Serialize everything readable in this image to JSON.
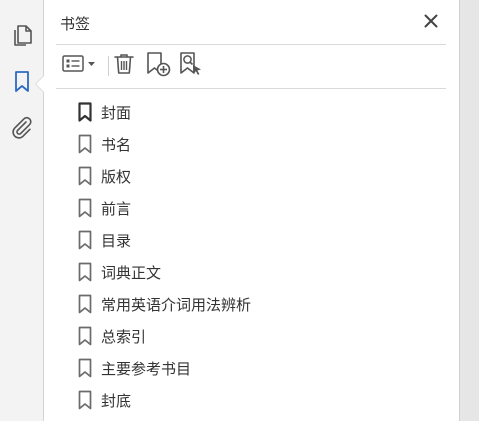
{
  "panel": {
    "title": "书签"
  },
  "icons": {
    "pages": "pages-icon",
    "bookmarks": "bookmark-icon",
    "attachments": "paperclip-icon",
    "close": "close-icon",
    "options": "options-menu-icon",
    "delete": "trash-icon",
    "new_bookmark": "new-bookmark-icon",
    "find_bookmark": "find-bookmark-icon"
  },
  "colors": {
    "accent": "#2d6bbf",
    "icon_gray": "#555555",
    "bookmark_gray": "#6b6b6b"
  },
  "bookmarks": [
    {
      "label": "封面",
      "active": true
    },
    {
      "label": "书名"
    },
    {
      "label": "版权"
    },
    {
      "label": "前言"
    },
    {
      "label": "目录"
    },
    {
      "label": "词典正文"
    },
    {
      "label": "常用英语介词用法辨析"
    },
    {
      "label": "总索引"
    },
    {
      "label": "主要参考书目"
    },
    {
      "label": "封底"
    }
  ]
}
